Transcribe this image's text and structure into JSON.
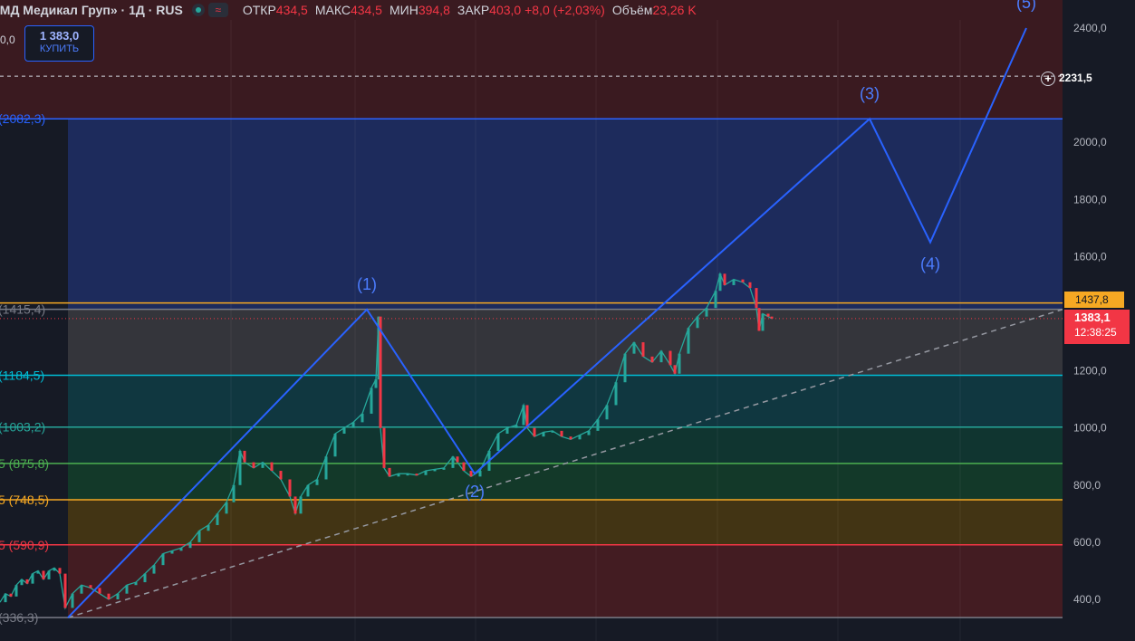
{
  "header": {
    "title": "«МД Медикал Груп» · 1Д · RUS",
    "items": [
      {
        "k": "ОТКР",
        "v": "434,5"
      },
      {
        "k": "МАКС",
        "v": "434,5"
      },
      {
        "k": "МИН",
        "v": "394,8"
      },
      {
        "k": "ЗАКР",
        "v": "403,0 +8,0 (+2,03%)"
      },
      {
        "k": "Объём",
        "v": "23,26 K"
      }
    ]
  },
  "buy_button": {
    "price": "1 383,0",
    "label": "КУПИТЬ"
  },
  "left_cut_text": "0,0",
  "chart_data": {
    "type": "candlestick",
    "yaxis": {
      "min": 336,
      "max": 2420,
      "ticks": [
        400,
        600,
        800,
        1000,
        1200,
        1400,
        1600,
        1800,
        2000,
        2200,
        2400
      ],
      "labels": [
        "400,0",
        "600,0",
        "800,0",
        "1000,0",
        "1200,0",
        "",
        "1600,0",
        "1800,0",
        "2000,0",
        "",
        "2400,0"
      ]
    },
    "fib_levels": [
      {
        "value": 2082.3,
        "label": "(2082,3)",
        "color": "#2962ff"
      },
      {
        "value": 1415.4,
        "label": "(1415,4)",
        "color": "#787b86"
      },
      {
        "value": 1184.5,
        "label": "(1184,5)",
        "color": "#00bcd4"
      },
      {
        "value": 1003.2,
        "label": "(1003,2)",
        "color": "#26a69a"
      },
      {
        "value": 875.8,
        "label": "5 (875,8)",
        "color": "#4caf50"
      },
      {
        "value": 748.5,
        "label": "5 (748,5)",
        "color": "#f6a823"
      },
      {
        "value": 590.9,
        "label": "5 (590,9)",
        "color": "#f23645"
      },
      {
        "value": 336.3,
        "label": "(336,3)",
        "color": "#787b86"
      }
    ],
    "waves": [
      {
        "label": "(1)",
        "value": 1415
      },
      {
        "label": "(2)",
        "value": 840
      },
      {
        "label": "(3)",
        "value": 2082
      },
      {
        "label": "(4)",
        "value": 1650
      },
      {
        "label": "(5)",
        "value": 2400
      }
    ],
    "crosshair": {
      "value": 2231.5,
      "label": "2231,5"
    },
    "orange_line": {
      "value": 1437.8,
      "label": "1437,8"
    },
    "last_price": {
      "value": 1383.1,
      "label": "1383,1",
      "timer": "12:38:25"
    },
    "series_path": [
      [
        0,
        390
      ],
      [
        6,
        420
      ],
      [
        12,
        410
      ],
      [
        18,
        450
      ],
      [
        24,
        470
      ],
      [
        30,
        455
      ],
      [
        36,
        490
      ],
      [
        42,
        500
      ],
      [
        48,
        470
      ],
      [
        54,
        500
      ],
      [
        60,
        510
      ],
      [
        66,
        490
      ],
      [
        72,
        370
      ],
      [
        80,
        420
      ],
      [
        90,
        450
      ],
      [
        100,
        440
      ],
      [
        110,
        420
      ],
      [
        120,
        400
      ],
      [
        130,
        420
      ],
      [
        140,
        450
      ],
      [
        150,
        460
      ],
      [
        160,
        490
      ],
      [
        170,
        520
      ],
      [
        180,
        560
      ],
      [
        190,
        570
      ],
      [
        200,
        580
      ],
      [
        210,
        600
      ],
      [
        220,
        640
      ],
      [
        230,
        660
      ],
      [
        240,
        700
      ],
      [
        250,
        740
      ],
      [
        258,
        800
      ],
      [
        265,
        920
      ],
      [
        270,
        880
      ],
      [
        280,
        860
      ],
      [
        290,
        880
      ],
      [
        300,
        850
      ],
      [
        310,
        820
      ],
      [
        320,
        760
      ],
      [
        326,
        700
      ],
      [
        332,
        760
      ],
      [
        340,
        800
      ],
      [
        350,
        820
      ],
      [
        360,
        900
      ],
      [
        370,
        980
      ],
      [
        380,
        1000
      ],
      [
        390,
        1020
      ],
      [
        400,
        1050
      ],
      [
        410,
        1140
      ],
      [
        415,
        1170
      ],
      [
        418,
        1390
      ],
      [
        420,
        1000
      ],
      [
        424,
        860
      ],
      [
        430,
        830
      ],
      [
        440,
        840
      ],
      [
        450,
        840
      ],
      [
        460,
        835
      ],
      [
        470,
        850
      ],
      [
        480,
        855
      ],
      [
        490,
        860
      ],
      [
        500,
        900
      ],
      [
        505,
        880
      ],
      [
        512,
        850
      ],
      [
        520,
        830
      ],
      [
        530,
        850
      ],
      [
        540,
        920
      ],
      [
        550,
        980
      ],
      [
        560,
        1000
      ],
      [
        570,
        1010
      ],
      [
        578,
        1080
      ],
      [
        582,
        1000
      ],
      [
        590,
        970
      ],
      [
        600,
        985
      ],
      [
        610,
        990
      ],
      [
        620,
        970
      ],
      [
        630,
        960
      ],
      [
        640,
        975
      ],
      [
        650,
        990
      ],
      [
        660,
        1030
      ],
      [
        670,
        1080
      ],
      [
        680,
        1160
      ],
      [
        690,
        1260
      ],
      [
        700,
        1300
      ],
      [
        710,
        1250
      ],
      [
        720,
        1230
      ],
      [
        730,
        1270
      ],
      [
        740,
        1220
      ],
      [
        745,
        1190
      ],
      [
        750,
        1260
      ],
      [
        760,
        1350
      ],
      [
        770,
        1390
      ],
      [
        780,
        1420
      ],
      [
        790,
        1480
      ],
      [
        795,
        1540
      ],
      [
        800,
        1500
      ],
      [
        810,
        1520
      ],
      [
        820,
        1510
      ],
      [
        828,
        1490
      ],
      [
        835,
        1420
      ],
      [
        838,
        1340
      ],
      [
        842,
        1400
      ],
      [
        848,
        1390
      ],
      [
        852,
        1383
      ]
    ]
  }
}
